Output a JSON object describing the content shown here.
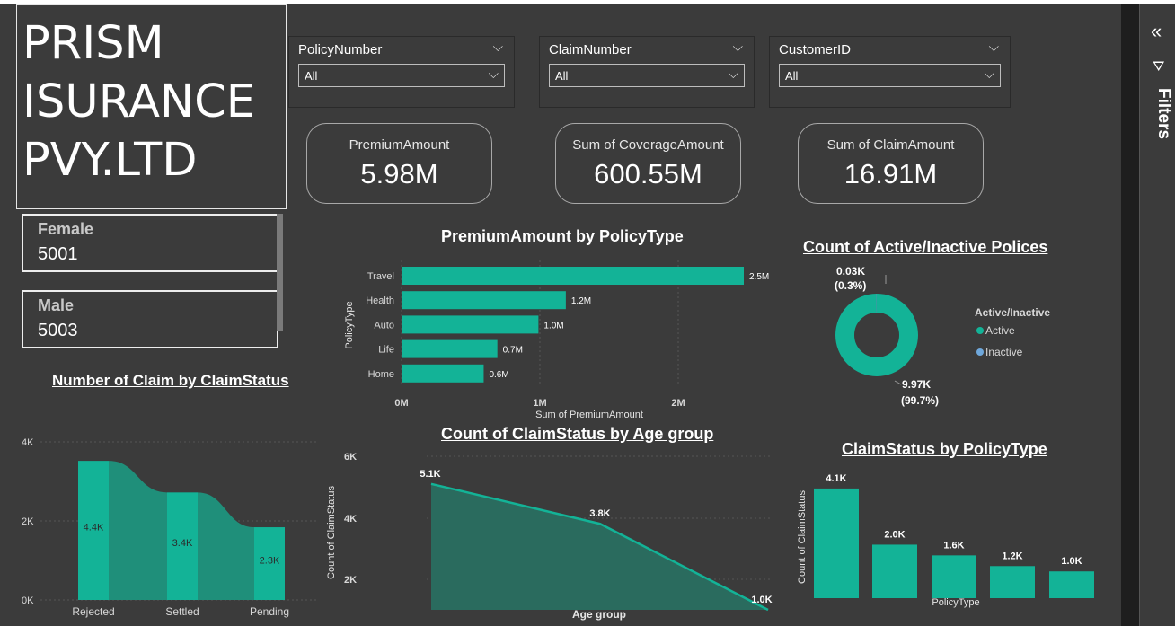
{
  "title_lines": [
    "PRISM",
    "ISURANCE",
    "PVY.LTD"
  ],
  "gender_cards": [
    {
      "label": "Female",
      "value": "5001"
    },
    {
      "label": "Male",
      "value": "5003"
    }
  ],
  "slicers": [
    {
      "label": "PolicyNumber",
      "value": "All"
    },
    {
      "label": "ClaimNumber",
      "value": "All"
    },
    {
      "label": "CustomerID",
      "value": "All"
    }
  ],
  "kpis": [
    {
      "label": "PremiumAmount",
      "value": "5.98M"
    },
    {
      "label": "Sum of CoverageAmount",
      "value": "600.55M"
    },
    {
      "label": "Sum of ClaimAmount",
      "value": "16.91M"
    }
  ],
  "filters_pane": {
    "label": "Filters",
    "collapse_icon": "double-chevron-left-icon",
    "filter_icon": "funnel-icon"
  },
  "colors": {
    "accent": "#13b397",
    "area": "#2a6b5e",
    "canvas": "#3b3b3b",
    "inactive": "#6fa8dc"
  },
  "chart_data": [
    {
      "id": "premium_by_policytype",
      "type": "bar",
      "orientation": "horizontal",
      "title": "PremiumAmount by PolicyType",
      "xlabel": "Sum of PremiumAmount",
      "ylabel": "PolicyType",
      "categories": [
        "Travel",
        "Health",
        "Auto",
        "Life",
        "Home"
      ],
      "values": [
        2500000,
        1200000,
        1000000,
        700000,
        600000
      ],
      "data_labels": [
        "2.5M",
        "1.2M",
        "1.0M",
        "0.7M",
        "0.6M"
      ],
      "xticks": [
        "0M",
        "1M",
        "2M"
      ],
      "xlim": [
        0,
        2500000
      ]
    },
    {
      "id": "active_inactive_donut",
      "type": "pie",
      "donut": true,
      "title": "Count of Active/Inactive Polices",
      "legend_title": "Active/Inactive",
      "legend_position": "right",
      "categories": [
        "Active",
        "Inactive"
      ],
      "values": [
        9970,
        30
      ],
      "data_labels": [
        [
          "9.97K",
          "(99.7%)"
        ],
        [
          "0.03K",
          "(0.3%)"
        ]
      ]
    },
    {
      "id": "claims_by_status",
      "type": "bar",
      "title": "Number of Claim by ClaimStatus",
      "categories": [
        "Rejected",
        "Settled",
        "Pending"
      ],
      "values": [
        4400,
        3400,
        2300
      ],
      "data_labels": [
        "4.4K",
        "3.4K",
        "2.3K"
      ],
      "yticks": [
        "0K",
        "2K",
        "4K"
      ],
      "ylim": [
        0,
        5000
      ]
    },
    {
      "id": "claimstatus_by_agegroup",
      "type": "area",
      "title": "Count of ClaimStatus by Age group",
      "xlabel": "Age group",
      "ylabel": "Count of ClaimStatus",
      "values": [
        5100,
        3800,
        1000
      ],
      "data_labels": [
        "5.1K",
        "3.8K",
        "1.0K"
      ],
      "yticks": [
        "2K",
        "4K",
        "6K"
      ],
      "ylim": [
        1000,
        6000
      ]
    },
    {
      "id": "claimstatus_by_policytype",
      "type": "bar",
      "title": "ClaimStatus by PolicyType",
      "xlabel": "PolicyType",
      "ylabel": "Count of ClaimStatus",
      "values": [
        4100,
        2000,
        1600,
        1200,
        1000
      ],
      "data_labels": [
        "4.1K",
        "2.0K",
        "1.6K",
        "1.2K",
        "1.0K"
      ],
      "ylim": [
        0,
        4500
      ]
    }
  ]
}
